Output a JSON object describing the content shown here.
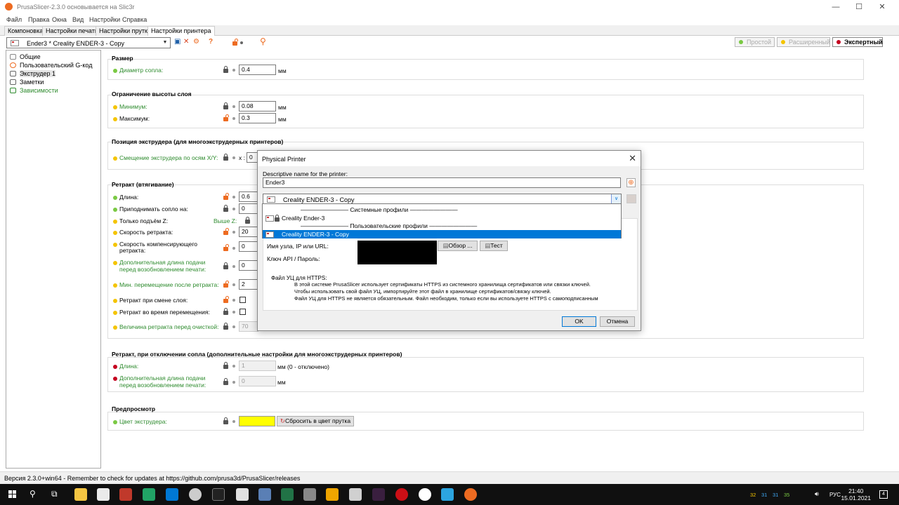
{
  "window": {
    "title": "PrusaSlicer-2.3.0 основывается на Slic3r",
    "controls": {
      "min": "—",
      "max": "☐",
      "close": "✕"
    }
  },
  "menu": [
    "Файл",
    "Правка",
    "Окна",
    "Вид",
    "Настройки",
    "Справка"
  ],
  "tabs": [
    "Компоновка",
    "Настройки печати",
    "Настройки прутка",
    "Настройки принтера"
  ],
  "toolbar": {
    "preset": "Ender3 * Creality ENDER-3 - Copy",
    "help": "?",
    "modes": {
      "simple": "Простой",
      "advanced": "Расширенный",
      "expert": "Экспертный"
    }
  },
  "sidebar": {
    "items": [
      "Общие",
      "Пользовательский G-код",
      "Экструдер 1",
      "Заметки",
      "Зависимости"
    ]
  },
  "sections": {
    "size": {
      "title": "Размер",
      "nozzle_label": "Диаметр сопла:",
      "nozzle_value": "0.4",
      "unit": "мм"
    },
    "layer": {
      "title": "Ограничение высоты слоя",
      "min_label": "Минимум:",
      "min_value": "0.08",
      "max_label": "Максимум:",
      "max_value": "0.3",
      "unit": "мм"
    },
    "extruder_pos": {
      "title": "Позиция экструдера (для многоэкструдерных принтеров)",
      "offset_label": "Смещение экструдера по осям X/Y:",
      "x_label": "x :",
      "x_value": "0"
    },
    "retract": {
      "title": "Ретракт (втягивание)",
      "length_label": "Длина:",
      "length_value": "0.6",
      "lift_label": "Приподнимать сопло на:",
      "lift_value": "0",
      "only_lift_label": "Только подъём Z:",
      "above_label": "Выше Z:",
      "speed_label": "Скорость ретракта:",
      "speed_value": "20",
      "deretract_label_1": "Скорость компенсирующего",
      "deretract_label_2": "ретракта:",
      "deretract_value": "0",
      "extra_label_1": "Дополнительная длина подачи",
      "extra_label_2": "перед возобновлением печати:",
      "extra_value": "0",
      "min_travel_label": "Мин. перемещение после ретракта:",
      "min_travel_value": "2",
      "layer_change_label": "Ретракт при смене слоя:",
      "wipe_label": "Ретракт во время перемещения:",
      "before_wipe_label": "Величина ретракта перед очисткой:",
      "before_wipe_value": "70"
    },
    "retract_tc": {
      "title": "Ретракт, при отключении сопла (дополнительные настройки для многоэкструдерных принтеров)",
      "length_label": "Длина:",
      "length_value": "1",
      "length_unit": "мм (0 - отключено)",
      "extra_label_1": "Дополнительная длина подачи",
      "extra_label_2": "перед возобновлением печати:",
      "extra_value": "0",
      "unit": "мм"
    },
    "preview": {
      "title": "Предпросмотр",
      "color_label": "Цвет экструдера:",
      "reset_button": "Сбросить в цвет прутка",
      "color": "#ffff00"
    }
  },
  "dialog": {
    "title": "Physical Printer",
    "name_label": "Descriptive name for the printer:",
    "name_value": "Ender3",
    "preset_value": "Creality ENDER-3 - Copy",
    "dropdown": {
      "system_caption": "———————— Системные профили ————————",
      "system_item": "Creality Ender-3",
      "user_caption": "———————— Пользовательские профили ————————",
      "user_item": "Creality ENDER-3 - Copy"
    },
    "host_label": "Имя узла, IP или URL:",
    "browse_button": "Обзор ...",
    "test_button": "Тест",
    "api_label": "Ключ API / Пароль:",
    "https_label": "Файл УЦ для HTTPS:",
    "https_text_1": "В этой системе PrusaSlicer использует сертификаты HTTPS из системного хранилища сертификатов или связки ключей.",
    "https_text_2": "Чтобы использовать свой файл УЦ, импортируйте этот файл в хранилище сертификатов/связку ключей.",
    "https_text_3": "Файл УЦ для HTTPS не является обязательным. Файл необходим, только если вы используете HTTPS с самоподписанным",
    "ok_button": "OK",
    "cancel_button": "Отмена"
  },
  "status": "Версия 2.3.0+win64 - Remember to check for updates at https://github.com/prusa3d/PrusaSlicer/releases",
  "taskbar": {
    "tray_numbers": [
      "32",
      "31",
      "31",
      "35"
    ],
    "lang": "РУС",
    "time": "21:40",
    "date": "15.01.2021",
    "notifications": "4"
  }
}
